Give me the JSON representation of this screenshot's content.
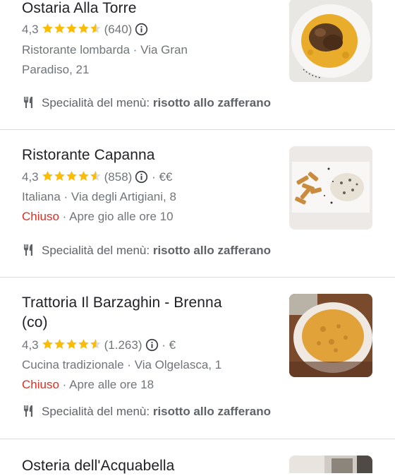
{
  "results": [
    {
      "name": "Ostaria Alla Torre",
      "rating": "4,3",
      "reviews": "(640)",
      "price": "",
      "category_line_1": "Ristorante lombarda · Via Gran",
      "category_line_2": "Paradiso, 21",
      "status": "",
      "status_detail": "",
      "specialty_label": "Specialità del menù:",
      "specialty_value": "risotto allo zafferano",
      "thumb_icon": "risotto-plate-photo"
    },
    {
      "name": "Ristorante Capanna",
      "rating": "4,3",
      "reviews": "(858)",
      "price": "· €€",
      "category_line_1": "Italiana · Via degli Artigiani, 8",
      "status": "Chiuso",
      "status_detail": "· Apre gio alle ore 10",
      "specialty_label": "Specialità del menù:",
      "specialty_value": "risotto allo zafferano",
      "thumb_icon": "pasta-plate-photo"
    },
    {
      "name_line_1": "Trattoria Il Barzaghin - Brenna",
      "name_line_2": "(co)",
      "rating": "4,3",
      "reviews": "(1.263)",
      "price": "· €",
      "category_line_1": "Cucina tradizionale · Via Olgelasca, 1",
      "status": "Chiuso",
      "status_detail": "· Apre alle ore 18",
      "specialty_label": "Specialità del menù:",
      "specialty_value": "risotto allo zafferano",
      "thumb_icon": "risotto-bowl-photo"
    },
    {
      "name": "Osteria dell'Acquabella",
      "thumb_icon": "restaurant-photo"
    }
  ],
  "colors": {
    "star": "#fbbc04",
    "closed": "#d93025",
    "meta": "#70757a"
  },
  "stars_filled": 4.3
}
